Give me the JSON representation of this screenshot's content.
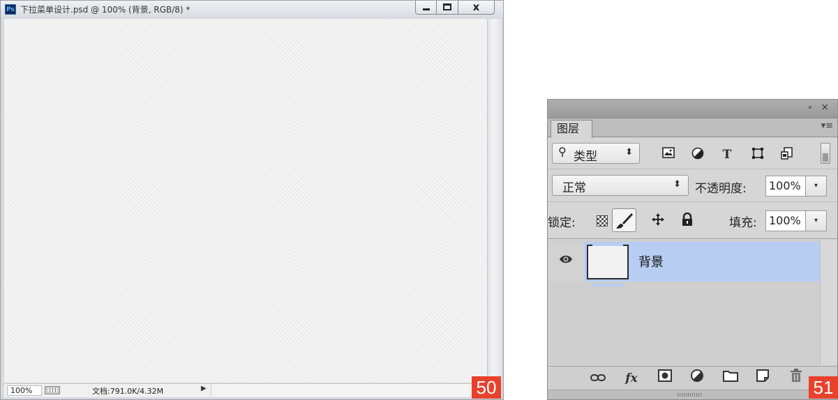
{
  "document": {
    "app_icon": "Ps",
    "title": "下拉菜单设计.psd @ 100% (背景, RGB/8) *",
    "window_buttons": {
      "minimize": "minimize-icon",
      "maximize": "maximize-icon",
      "close": "close-icon"
    },
    "close_glyph": "x",
    "status": {
      "zoom": "100%",
      "doc_info": "文档:791.0K/4.32M",
      "arrow": "▶"
    },
    "badge": "50"
  },
  "layers_panel": {
    "header_icons": {
      "collapse": "«",
      "close": "×"
    },
    "tab_label": "图层",
    "menu_glyph": "▾≡",
    "filter": {
      "search_glyph": "⚲",
      "label": "类型",
      "updown": "⬍",
      "icons": [
        "image-filter-icon",
        "adjustment-filter-icon",
        "type-filter-icon",
        "shape-filter-icon",
        "smart-object-filter-icon"
      ],
      "type_glyph": "T"
    },
    "blend": {
      "mode": "正常",
      "updown": "⬍",
      "opacity_label": "不透明度:",
      "opacity": "100%",
      "dd": "▾"
    },
    "lock": {
      "label": "锁定:",
      "fill_label": "填充:",
      "fill": "100%",
      "dd": "▾"
    },
    "layers": [
      {
        "name": "背景",
        "visible": true,
        "selected": true
      }
    ],
    "footer_icons": [
      "link-icon",
      "fx-icon",
      "mask-icon",
      "adjustment-icon",
      "folder-icon",
      "new-layer-icon",
      "trash-icon"
    ],
    "footer_fx": "fx",
    "badge": "51"
  },
  "colors": {
    "selection": "#b7cdf2",
    "badge": "#e8412c"
  }
}
